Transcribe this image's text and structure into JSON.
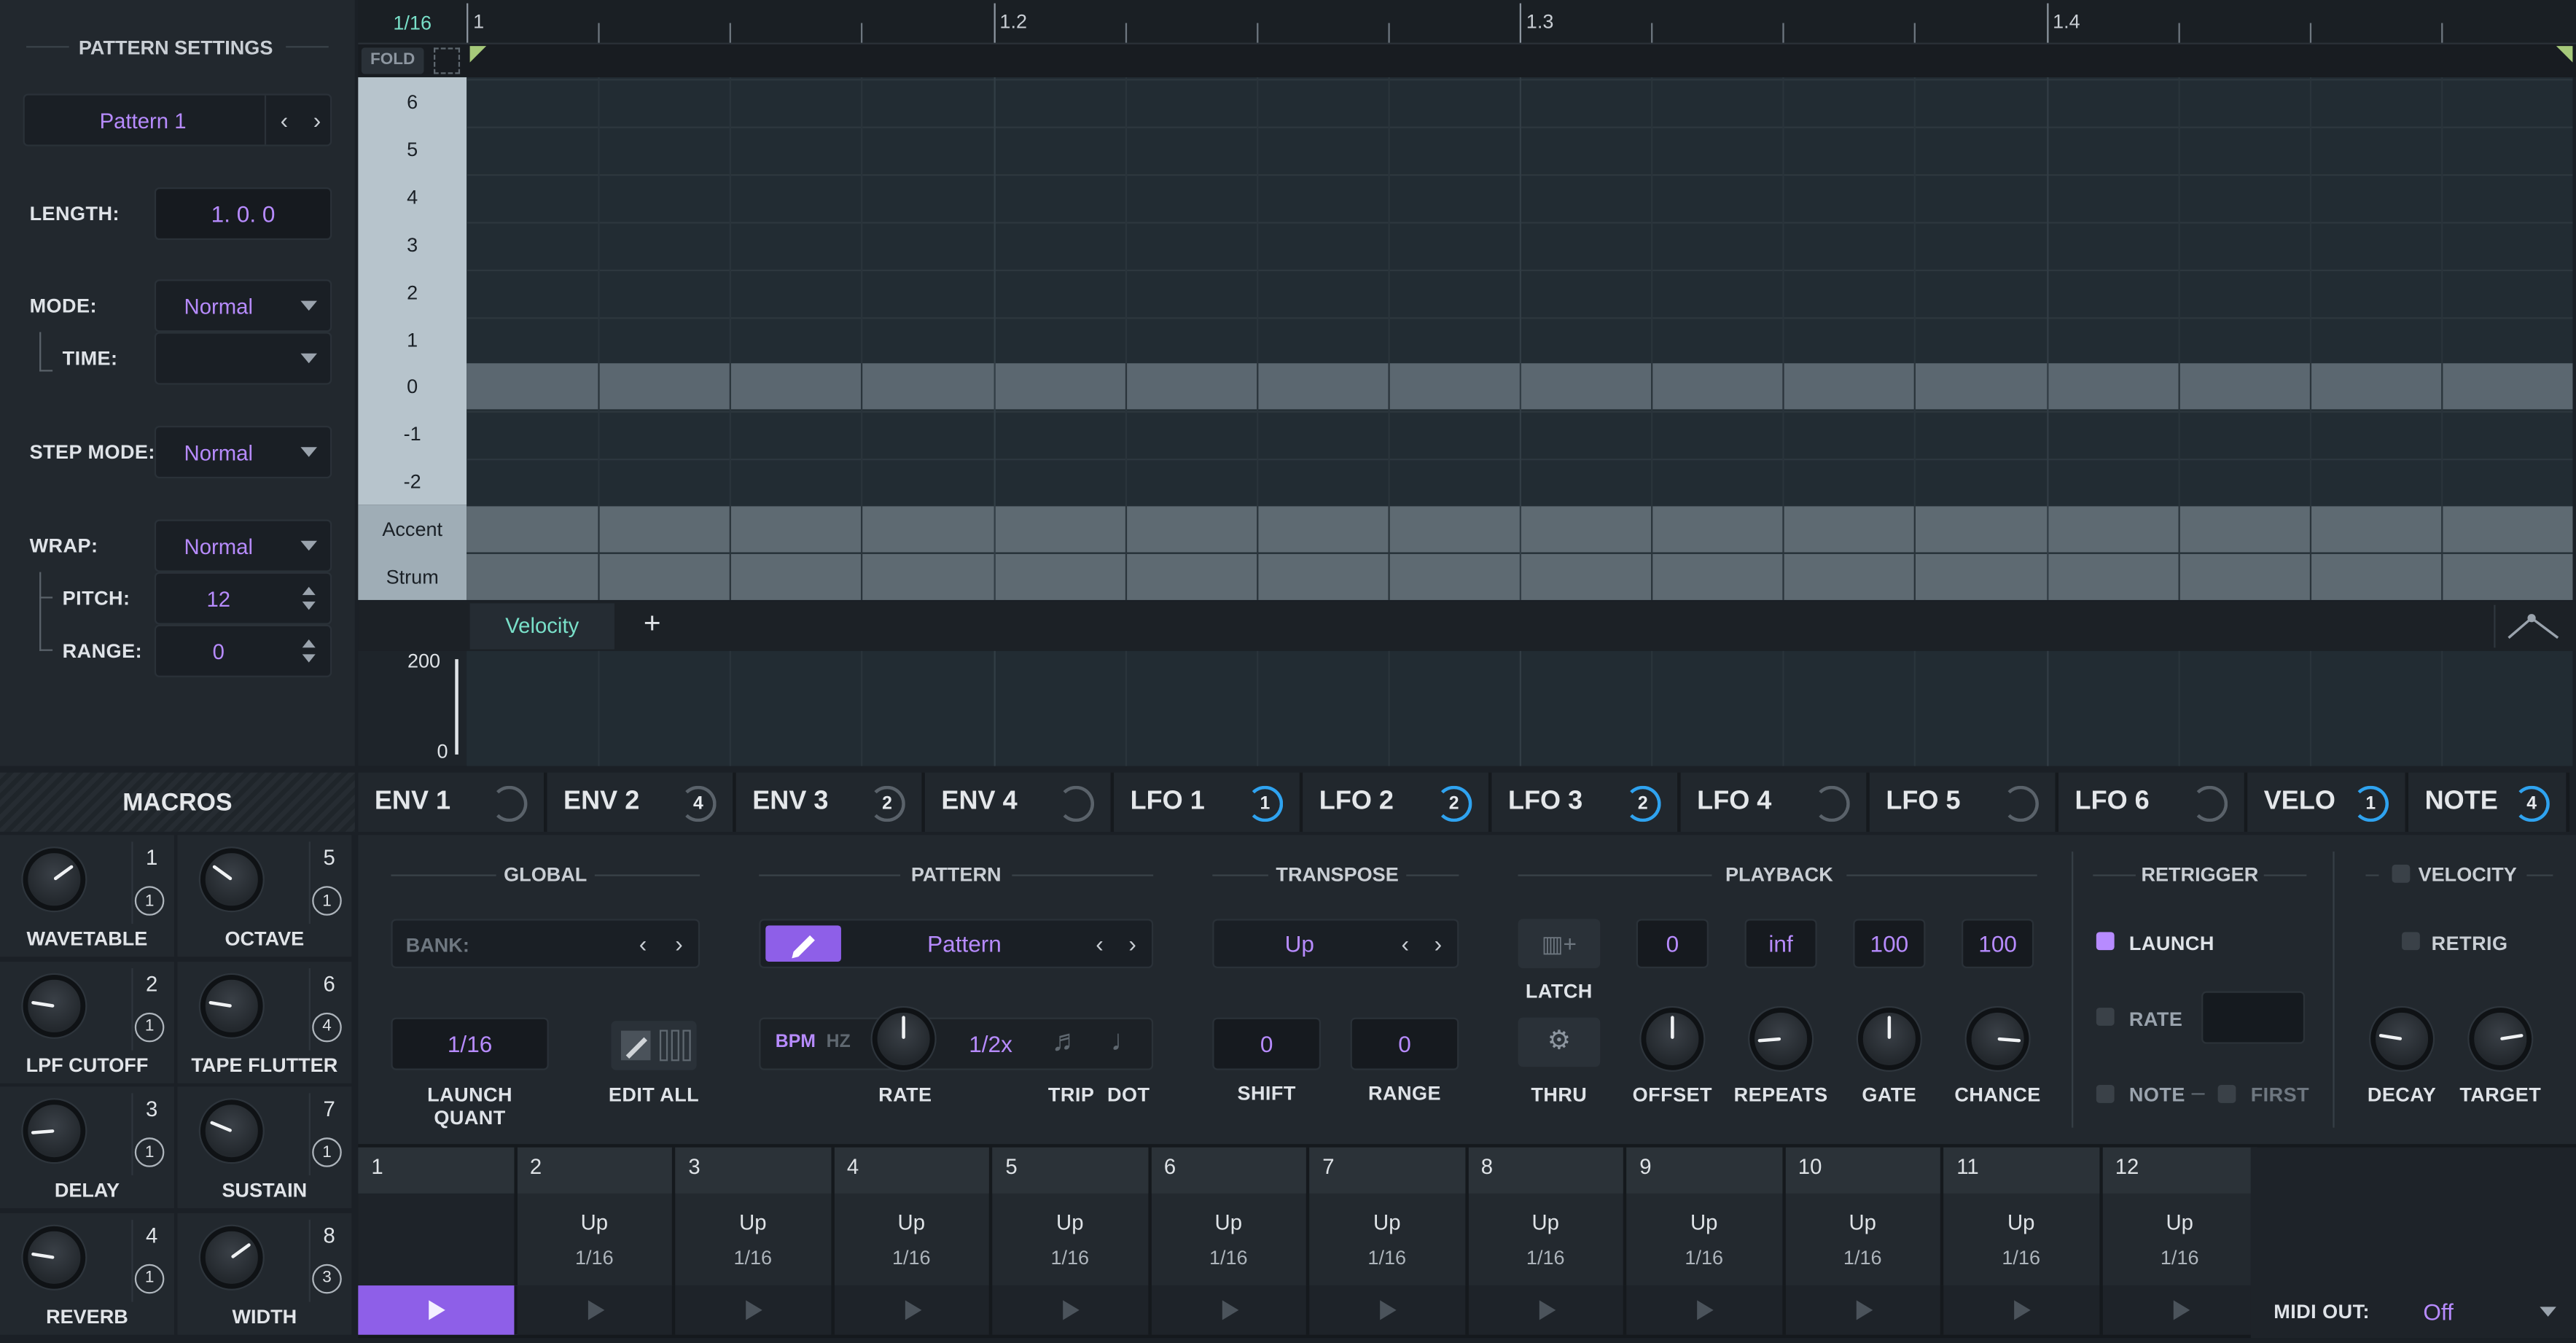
{
  "pattern_settings": {
    "title": "PATTERN SETTINGS",
    "pattern_name": "Pattern 1",
    "length_label": "LENGTH:",
    "length_value": "1. 0. 0",
    "mode_label": "MODE:",
    "mode_value": "Normal",
    "time_label": "TIME:",
    "time_value": "",
    "step_mode_label": "STEP MODE:",
    "step_mode_value": "Normal",
    "wrap_label": "WRAP:",
    "wrap_value": "Normal",
    "pitch_label": "PITCH:",
    "pitch_value": "12",
    "range_label": "RANGE:",
    "range_value": "0"
  },
  "sequencer": {
    "grid_label": "1/16",
    "fold_label": "FOLD",
    "bar_markers": [
      "1",
      "1.2",
      "1.3",
      "1.4"
    ],
    "row_labels": [
      "6",
      "5",
      "4",
      "3",
      "2",
      "1",
      "0",
      "-1",
      "-2",
      "Accent",
      "Strum"
    ],
    "lane_tab": "Velocity",
    "lane_add": "+",
    "lane_max": "200",
    "lane_min": "0"
  },
  "macros": {
    "title": "MACROS",
    "items": [
      {
        "name": "WAVETABLE",
        "num": "1",
        "mods": "1",
        "value": 0.7
      },
      {
        "name": "OCTAVE",
        "num": "5",
        "mods": "1",
        "value": 0.3
      },
      {
        "name": "LPF CUTOFF",
        "num": "2",
        "mods": "1",
        "value": 0.2
      },
      {
        "name": "TAPE FLUTTER",
        "num": "6",
        "mods": "4",
        "value": 0.2
      },
      {
        "name": "DELAY",
        "num": "3",
        "mods": "1",
        "value": 0.15
      },
      {
        "name": "SUSTAIN",
        "num": "7",
        "mods": "1",
        "value": 0.25
      },
      {
        "name": "REVERB",
        "num": "4",
        "mods": "1",
        "value": 0.2
      },
      {
        "name": "WIDTH",
        "num": "8",
        "mods": "3",
        "value": 0.7
      }
    ]
  },
  "mod_tabs": [
    {
      "label": "ENV 1",
      "count": "",
      "active": false
    },
    {
      "label": "ENV 2",
      "count": "4",
      "active": false
    },
    {
      "label": "ENV 3",
      "count": "2",
      "active": false
    },
    {
      "label": "ENV 4",
      "count": "",
      "active": false
    },
    {
      "label": "LFO 1",
      "count": "1",
      "active": true
    },
    {
      "label": "LFO 2",
      "count": "2",
      "active": true
    },
    {
      "label": "LFO 3",
      "count": "2",
      "active": true
    },
    {
      "label": "LFO 4",
      "count": "",
      "active": false
    },
    {
      "label": "LFO 5",
      "count": "",
      "active": false
    },
    {
      "label": "LFO 6",
      "count": "",
      "active": false
    },
    {
      "label": "VELO",
      "count": "1",
      "active": true
    },
    {
      "label": "NOTE",
      "count": "4",
      "active": true
    }
  ],
  "global": {
    "title": "GLOBAL",
    "bank_label": "BANK:",
    "launch_quant_value": "1/16",
    "launch_quant_label": "LAUNCH QUANT",
    "edit_all_label": "EDIT ALL"
  },
  "pattern": {
    "title": "PATTERN",
    "name": "Pattern",
    "bpm_label": "BPM",
    "hz_label": "HZ",
    "rate_value": "1/2x",
    "rate_label": "RATE",
    "trip_label": "TRIP",
    "dot_label": "DOT"
  },
  "transpose": {
    "title": "TRANSPOSE",
    "direction": "Up",
    "shift_value": "0",
    "shift_label": "SHIFT",
    "range_value": "0",
    "range_label": "RANGE"
  },
  "playback": {
    "title": "PLAYBACK",
    "latch_label": "LATCH",
    "thru_label": "THRU",
    "offset_value": "0",
    "offset_label": "OFFSET",
    "repeats_value": "inf",
    "repeats_label": "REPEATS",
    "gate_value": "100",
    "gate_label": "GATE",
    "chance_value": "100",
    "chance_label": "CHANCE"
  },
  "retrigger": {
    "title": "RETRIGGER",
    "launch_label": "LAUNCH",
    "rate_label": "RATE",
    "note_label": "NOTE",
    "first_label": "FIRST"
  },
  "velocity": {
    "title": "VELOCITY",
    "retrig_label": "RETRIG",
    "decay_label": "DECAY",
    "target_label": "TARGET"
  },
  "steps": [
    {
      "num": "1",
      "dir": "",
      "rate": ""
    },
    {
      "num": "2",
      "dir": "Up",
      "rate": "1/16"
    },
    {
      "num": "3",
      "dir": "Up",
      "rate": "1/16"
    },
    {
      "num": "4",
      "dir": "Up",
      "rate": "1/16"
    },
    {
      "num": "5",
      "dir": "Up",
      "rate": "1/16"
    },
    {
      "num": "6",
      "dir": "Up",
      "rate": "1/16"
    },
    {
      "num": "7",
      "dir": "Up",
      "rate": "1/16"
    },
    {
      "num": "8",
      "dir": "Up",
      "rate": "1/16"
    },
    {
      "num": "9",
      "dir": "Up",
      "rate": "1/16"
    },
    {
      "num": "10",
      "dir": "Up",
      "rate": "1/16"
    },
    {
      "num": "11",
      "dir": "Up",
      "rate": "1/16"
    },
    {
      "num": "12",
      "dir": "Up",
      "rate": "1/16"
    }
  ],
  "midi_out": {
    "label": "MIDI OUT:",
    "value": "Off"
  },
  "colors": {
    "accent": "#b78bff",
    "blue": "#2fa3f0",
    "active_step": "#8e5fe8"
  }
}
